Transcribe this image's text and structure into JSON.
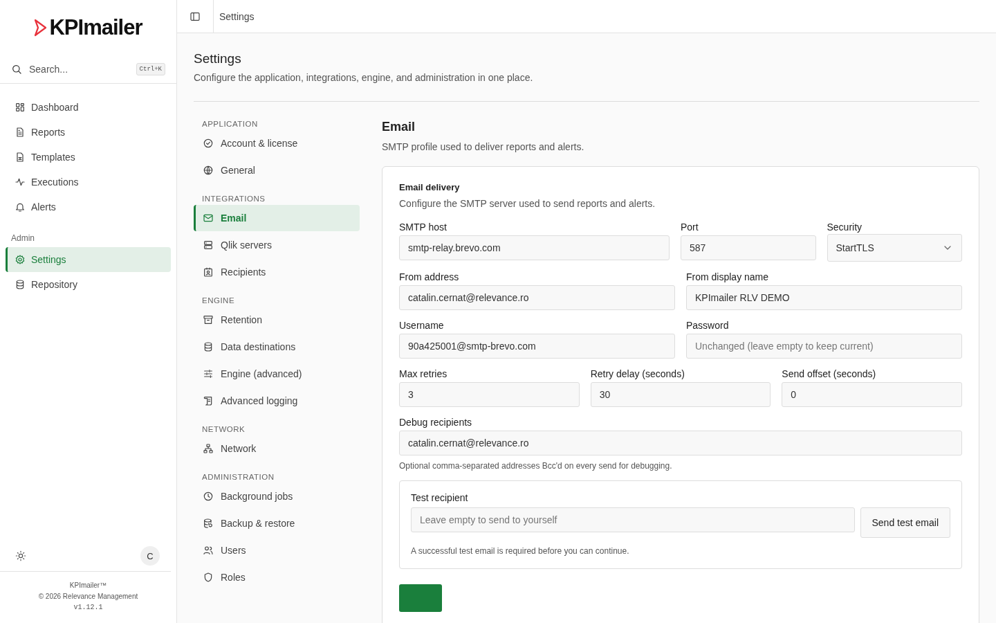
{
  "sidebar": {
    "logo": "KPImailer",
    "search": {
      "placeholder": "Search...",
      "shortcut": "Ctrl+K"
    },
    "nav": [
      {
        "label": "Dashboard",
        "selected": false
      },
      {
        "label": "Reports",
        "selected": false
      },
      {
        "label": "Templates",
        "selected": false
      },
      {
        "label": "Executions",
        "selected": false
      },
      {
        "label": "Alerts",
        "selected": false
      }
    ],
    "admin_heading": "Admin",
    "admin_nav": [
      {
        "label": "Settings",
        "selected": true
      },
      {
        "label": "Repository",
        "selected": false
      }
    ],
    "avatar": "C",
    "footer": {
      "product": "KPImailer™",
      "copyright": "© 2026 Relevance Management",
      "version": "v1.12.1"
    }
  },
  "topbar": {
    "breadcrumb": "Settings"
  },
  "page": {
    "title": "Settings",
    "subtitle": "Configure the application, integrations, engine, and administration in one place."
  },
  "settings_nav": [
    {
      "heading": "APPLICATION",
      "items": [
        {
          "label": "Account & license",
          "selected": false
        },
        {
          "label": "General",
          "selected": false
        }
      ]
    },
    {
      "heading": "INTEGRATIONS",
      "items": [
        {
          "label": "Email",
          "selected": true
        },
        {
          "label": "Qlik servers",
          "selected": false
        },
        {
          "label": "Recipients",
          "selected": false
        }
      ]
    },
    {
      "heading": "ENGINE",
      "items": [
        {
          "label": "Retention",
          "selected": false
        },
        {
          "label": "Data destinations",
          "selected": false
        },
        {
          "label": "Engine (advanced)",
          "selected": false
        },
        {
          "label": "Advanced logging",
          "selected": false
        }
      ]
    },
    {
      "heading": "NETWORK",
      "items": [
        {
          "label": "Network",
          "selected": false
        }
      ]
    },
    {
      "heading": "ADMINISTRATION",
      "items": [
        {
          "label": "Background jobs",
          "selected": false
        },
        {
          "label": "Backup & restore",
          "selected": false
        },
        {
          "label": "Users",
          "selected": false
        },
        {
          "label": "Roles",
          "selected": false
        }
      ]
    }
  ],
  "section": {
    "title": "Email",
    "subtitle": "SMTP profile used to deliver reports and alerts."
  },
  "card": {
    "title": "Email delivery",
    "subtitle": "Configure the SMTP server used to send reports and alerts.",
    "rows": [
      [
        {
          "label": "SMTP host",
          "value": "smtp-relay.brevo.com"
        },
        {
          "label": "Port",
          "value": "587"
        },
        {
          "label": "Security",
          "value": "StartTLS",
          "kind": "select"
        }
      ],
      [
        {
          "label": "From address",
          "value": "catalin.cernat@relevance.ro"
        },
        {
          "label": "From display name",
          "value": "KPImailer RLV DEMO"
        }
      ],
      [
        {
          "label": "Username",
          "value": "90a425001@smtp-brevo.com"
        },
        {
          "label": "Password",
          "placeholder": "Unchanged (leave empty to keep current)"
        }
      ],
      [
        {
          "label": "Max retries",
          "value": "3"
        },
        {
          "label": "Retry delay (seconds)",
          "value": "30"
        },
        {
          "label": "Send offset (seconds)",
          "value": "0"
        }
      ],
      [
        {
          "label": "Debug recipients",
          "value": "catalin.cernat@relevance.ro",
          "hint": "Optional comma-separated addresses Bcc'd on every send for debugging."
        }
      ]
    ],
    "test": {
      "label": "Test recipient",
      "placeholder": "Leave empty to send to yourself",
      "button": "Send test email",
      "note": "A successful test email is required before you can continue."
    }
  }
}
